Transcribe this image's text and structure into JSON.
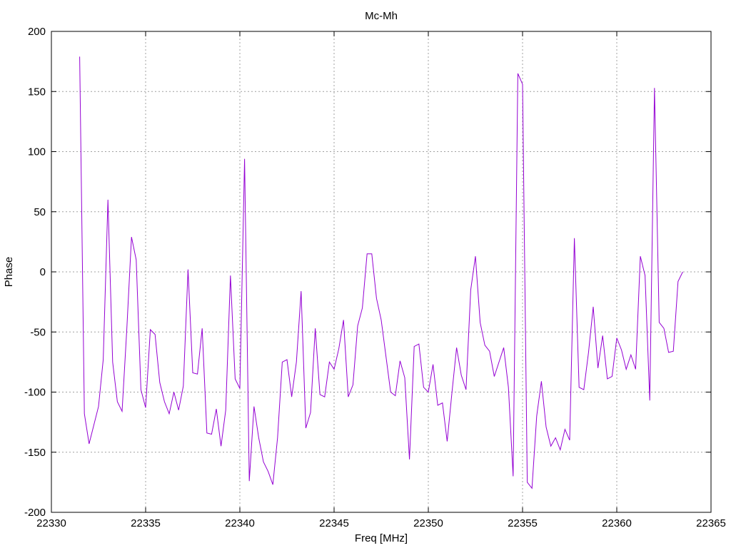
{
  "chart_data": {
    "type": "line",
    "title": "Mc-Mh",
    "xlabel": "Freq [MHz]",
    "ylabel": "Phase",
    "xlim": [
      22330,
      22365
    ],
    "ylim": [
      -200,
      200
    ],
    "xticks": [
      22330,
      22335,
      22340,
      22345,
      22350,
      22355,
      22360,
      22365
    ],
    "yticks": [
      -200,
      -150,
      -100,
      -50,
      0,
      50,
      100,
      150,
      200
    ],
    "grid": true,
    "legend": "none",
    "series": [
      {
        "color": "#9400d3",
        "x": [
          22331.5,
          22331.75,
          22332,
          22332.5,
          22332.75,
          22333,
          22333.25,
          22333.5,
          22333.75,
          22334,
          22334.25,
          22334.5,
          22334.75,
          22335,
          22335.25,
          22335.5,
          22335.75,
          22336,
          22336.25,
          22336.5,
          22336.75,
          22337,
          22337.25,
          22337.5,
          22337.75,
          22338,
          22338.25,
          22338.5,
          22338.75,
          22339,
          22339.25,
          22339.5,
          22339.75,
          22340,
          22340.25,
          22340.5,
          22340.75,
          22341,
          22341.25,
          22341.5,
          22341.75,
          22342,
          22342.25,
          22342.5,
          22342.75,
          22343,
          22343.25,
          22343.5,
          22343.75,
          22344,
          22344.25,
          22344.5,
          22344.75,
          22345,
          22345.25,
          22345.5,
          22345.75,
          22346,
          22346.25,
          22346.5,
          22346.75,
          22347,
          22347.25,
          22347.5,
          22347.75,
          22348,
          22348.25,
          22348.5,
          22348.75,
          22349,
          22349.25,
          22349.5,
          22349.75,
          22350,
          22350.25,
          22350.5,
          22350.75,
          22351,
          22351.25,
          22351.5,
          22351.75,
          22352,
          22352.25,
          22352.5,
          22352.75,
          22353,
          22353.25,
          22353.5,
          22353.75,
          22354,
          22354.25,
          22354.5,
          22354.75,
          22355,
          22355.25,
          22355.5,
          22355.75,
          22356,
          22356.25,
          22356.5,
          22356.75,
          22357,
          22357.25,
          22357.5,
          22357.75,
          22358,
          22358.25,
          22358.5,
          22358.75,
          22359,
          22359.25,
          22359.5,
          22359.75,
          22360,
          22360.25,
          22360.5,
          22360.75,
          22361,
          22361.25,
          22361.5,
          22361.75,
          22362,
          22362.25,
          22362.5,
          22362.75,
          22363,
          22363.25,
          22363.5
        ],
        "y": [
          179,
          -118,
          -143,
          -112,
          -73,
          60,
          -75,
          -108,
          -116,
          -48,
          29,
          10,
          -98,
          -113,
          -48,
          -52,
          -92,
          -108,
          -118,
          -100,
          -115,
          -95,
          2,
          -84,
          -85,
          -47,
          -134,
          -135,
          -114,
          -145,
          -115,
          -3,
          -89,
          -97,
          94,
          -174,
          -112,
          -138,
          -158,
          -166,
          -177,
          -138,
          -75,
          -73,
          -104,
          -75,
          -16,
          -130,
          -117,
          -47,
          -102,
          -104,
          -75,
          -81,
          -64,
          -40,
          -104,
          -94,
          -45,
          -30,
          15,
          15,
          -22,
          -40,
          -70,
          -100,
          -103,
          -74,
          -88,
          -156,
          -62,
          -60,
          -96,
          -100,
          -77,
          -111,
          -109,
          -141,
          -101,
          -63,
          -86,
          -98,
          -15,
          13,
          -42,
          -61,
          -66,
          -87,
          -75,
          -63,
          -96,
          -170,
          165,
          156,
          -175,
          -180,
          -120,
          -91,
          -129,
          -145,
          -138,
          -148,
          -131,
          -140,
          28,
          -96,
          -98,
          -67,
          -29,
          -80,
          -53,
          -89,
          -87,
          -55,
          -65,
          -81,
          -69,
          -81,
          13,
          -3,
          -107,
          153,
          -42,
          -47,
          -67,
          -66,
          -8,
          0
        ]
      }
    ]
  }
}
